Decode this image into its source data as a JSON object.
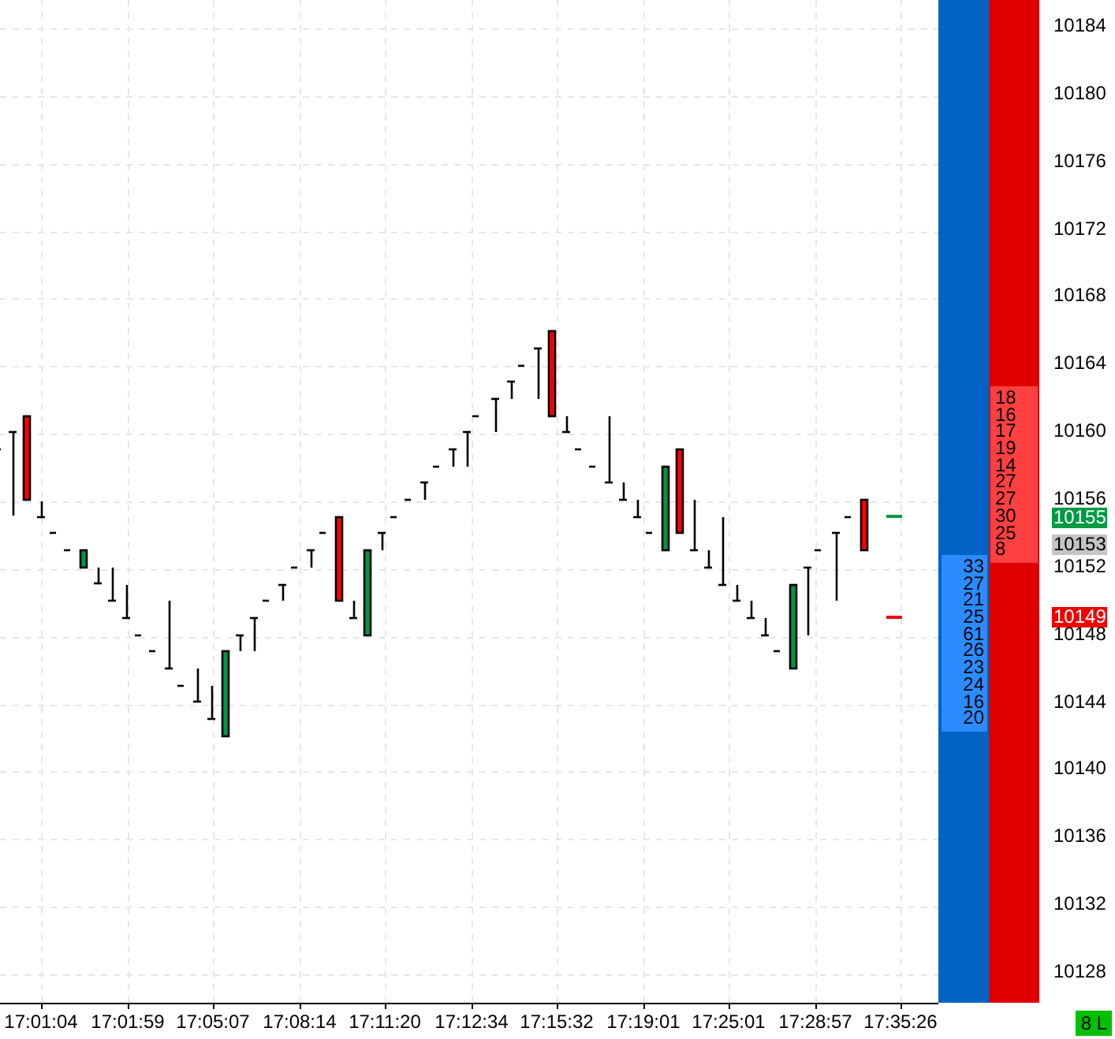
{
  "chart": {
    "price_axis": [
      "10184",
      "10180",
      "10176",
      "10172",
      "10168",
      "10164",
      "10160",
      "10156",
      "10152",
      "10148",
      "10144",
      "10140",
      "10136",
      "10132",
      "10128"
    ],
    "time_axis": [
      "17:01:04",
      "17:01:59",
      "17:05:07",
      "17:08:14",
      "17:11:20",
      "17:12:34",
      "17:15:32",
      "17:19:01",
      "17:25:01",
      "17:28:57",
      "17:35:26"
    ],
    "price_markers": [
      {
        "label": "10155",
        "kind": "buy"
      },
      {
        "label": "10153",
        "kind": "last"
      },
      {
        "label": "10149",
        "kind": "sell"
      }
    ]
  },
  "depth": {
    "ask_sizes": [
      "18",
      "16",
      "17",
      "19",
      "14",
      "27",
      "27",
      "30",
      "25",
      "8"
    ],
    "bid_sizes": [
      "33",
      "27",
      "21",
      "25",
      "61",
      "26",
      "23",
      "24",
      "16",
      "20"
    ]
  },
  "status_badge": "8 L"
}
